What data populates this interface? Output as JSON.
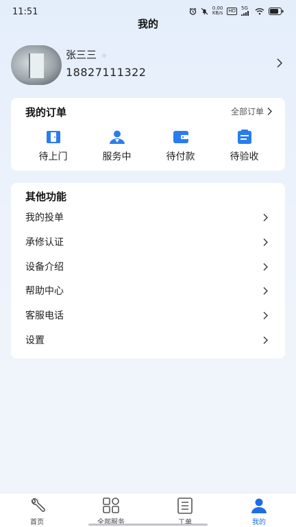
{
  "status_bar": {
    "time": "11:51",
    "net_speed_value": "0.00",
    "net_speed_unit": "KB/s",
    "hd_label": "HD",
    "signal_label": "5G"
  },
  "header": {
    "title": "我的"
  },
  "profile": {
    "name": "张三三",
    "phone": "18827111322"
  },
  "orders": {
    "title": "我的订单",
    "all_label": "全部订单",
    "items": [
      {
        "label": "待上门",
        "icon": "door-icon"
      },
      {
        "label": "服务中",
        "icon": "person-icon"
      },
      {
        "label": "待付款",
        "icon": "wallet-icon"
      },
      {
        "label": "待验收",
        "icon": "clipboard-icon"
      }
    ]
  },
  "features": {
    "title": "其他功能",
    "items": [
      {
        "label": "我的投单"
      },
      {
        "label": "承修认证"
      },
      {
        "label": "设备介绍"
      },
      {
        "label": "帮助中心"
      },
      {
        "label": "客服电话"
      },
      {
        "label": "设置"
      }
    ]
  },
  "tabbar": {
    "items": [
      {
        "label": "首页",
        "icon": "wrench-icon"
      },
      {
        "label": "全部服务",
        "icon": "grid-icon"
      },
      {
        "label": "工单",
        "icon": "document-icon"
      },
      {
        "label": "我的",
        "icon": "profile-icon",
        "active": true
      }
    ]
  },
  "colors": {
    "accent": "#1c6ee6",
    "icon_blue": "#2a7df0"
  }
}
